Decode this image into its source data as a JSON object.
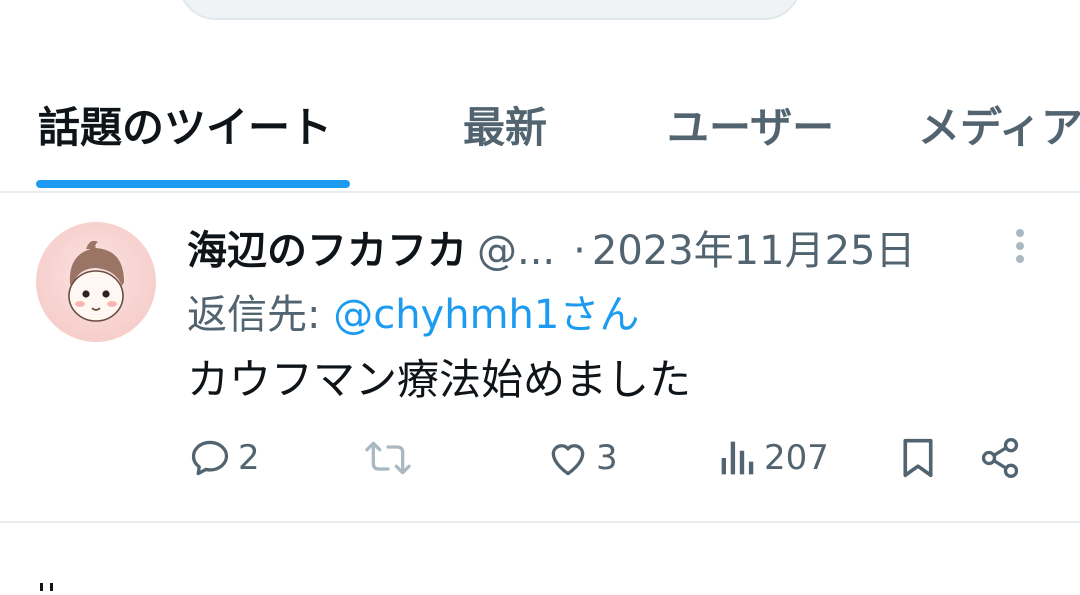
{
  "tabs": [
    {
      "label": "話題のツイート",
      "active": true
    },
    {
      "label": "最新",
      "active": false
    },
    {
      "label": "ユーザー",
      "active": false
    },
    {
      "label": "メディア",
      "active": false
    }
  ],
  "tweet": {
    "display_name": "海辺のフカフカ",
    "handle": "@...",
    "separator": "·",
    "date": "2023年11月25日",
    "reply_prefix": "返信先:",
    "reply_mention": "@chyhmh1さん",
    "text": "カウフマン療法始めました",
    "actions": {
      "reply": {
        "icon": "reply-icon",
        "count": "2"
      },
      "retweet": {
        "icon": "retweet-icon",
        "count": ""
      },
      "like": {
        "icon": "heart-icon",
        "count": "3"
      },
      "views": {
        "icon": "views-icon",
        "count": "207"
      },
      "bookmark": {
        "icon": "bookmark-icon"
      },
      "share": {
        "icon": "share-icon"
      }
    }
  },
  "colors": {
    "accent": "#1d9bf0",
    "text_primary": "#0f1419",
    "text_secondary": "#536471",
    "divider": "#e6ecf0"
  }
}
